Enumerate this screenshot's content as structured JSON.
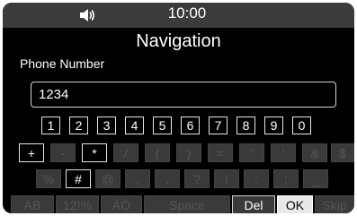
{
  "status": {
    "time": "10:00",
    "volume_icon": "volume-icon"
  },
  "title": "Navigation",
  "subtitle": "Phone Number",
  "entry": {
    "value": "1234"
  },
  "digits": [
    "1",
    "2",
    "3",
    "4",
    "5",
    "6",
    "7",
    "8",
    "9",
    "0"
  ],
  "row2": [
    "+",
    "-",
    "*",
    "/",
    "(",
    ")",
    "=",
    "\"",
    "'",
    "&",
    "$"
  ],
  "row3": [
    "%",
    "#",
    "@",
    ",",
    ".",
    "?",
    "!",
    ":",
    ";",
    "_"
  ],
  "bottom": {
    "ab": "AB",
    "num": "12!%",
    "ao": "ÄÖ",
    "space": "Space",
    "del": "Del",
    "ok": "OK",
    "skip": "Skip"
  }
}
